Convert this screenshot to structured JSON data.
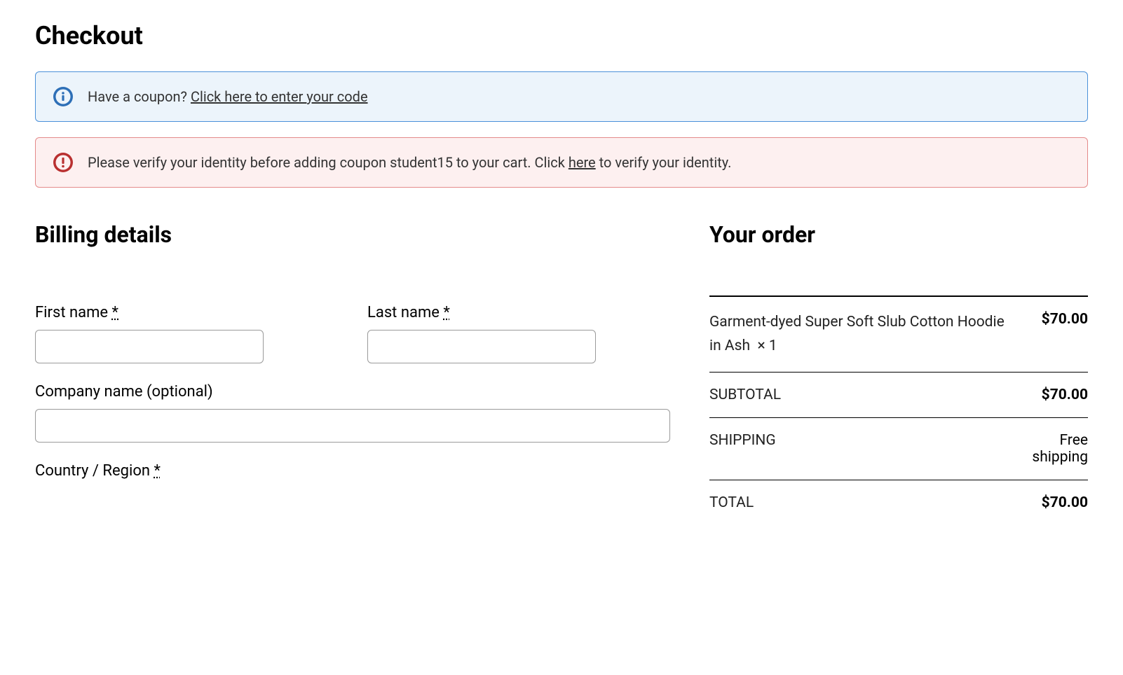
{
  "page_title": "Checkout",
  "coupon_notice": {
    "prefix": "Have a coupon? ",
    "link": "Click here to enter your code"
  },
  "error_notice": {
    "before": "Please verify your identity before adding coupon student15 to your cart. Click ",
    "link": "here",
    "after": " to verify your identity."
  },
  "billing": {
    "heading": "Billing details",
    "first_name_label": "First name ",
    "last_name_label": "Last name ",
    "company_label": "Company name (optional)",
    "country_label": "Country / Region ",
    "required_star": "*"
  },
  "order": {
    "heading": "Your order",
    "product_name": "Garment-dyed Super Soft Slub Cotton Hoodie in Ash",
    "product_qty": "× 1",
    "product_price": "$70.00",
    "subtotal_label": "SUBTOTAL",
    "subtotal_value": "$70.00",
    "shipping_label": "SHIPPING",
    "shipping_value": "Free shipping",
    "total_label": "TOTAL",
    "total_value": "$70.00"
  }
}
